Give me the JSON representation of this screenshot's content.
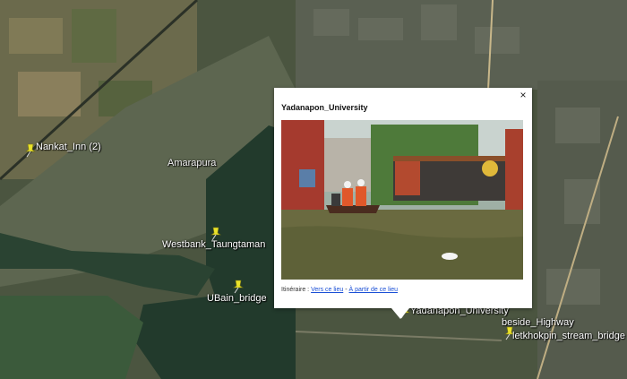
{
  "map": {
    "places": [
      {
        "label": "Nankat_Inn (2)",
        "type": "pin"
      },
      {
        "label": "Amarapura",
        "type": "town"
      },
      {
        "label": "Westbank_Taungtaman",
        "type": "pin"
      },
      {
        "label": "UBain_bridge",
        "type": "pin"
      },
      {
        "label": "Yadanapon_University",
        "type": "pin"
      },
      {
        "label": "beside_Highway",
        "type": "pin"
      },
      {
        "label": "letkhokpin_stream_bridge",
        "type": "pin"
      }
    ]
  },
  "popup": {
    "title": "Yadanapon_University",
    "close_symbol": "×",
    "photo_icon": "flooded-gate-photo",
    "directions_label": "Itinéraire :",
    "to_here": "Vers ce lieu",
    "separator": "-",
    "from_here": "À partir de ce lieu"
  },
  "colors": {
    "water": "#223a2c",
    "pin_yellow": "#e9e22a",
    "link": "#1a4fd6"
  }
}
